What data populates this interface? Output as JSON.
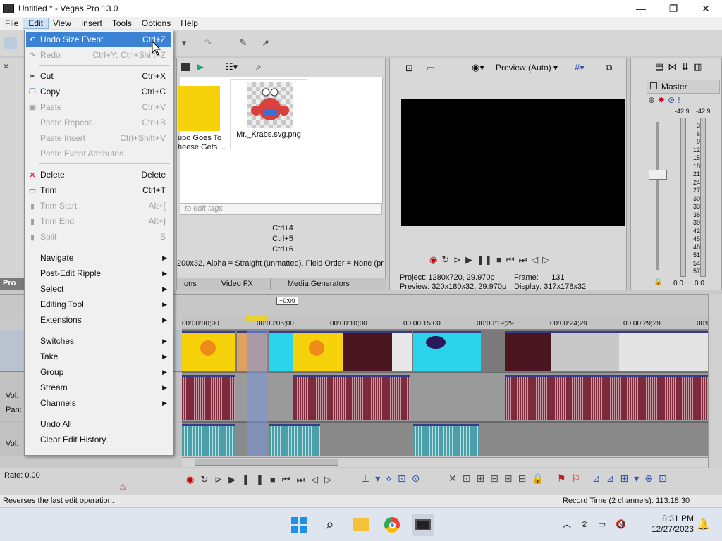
{
  "window": {
    "title": "Untitled * - Vegas Pro 13.0",
    "min": "—",
    "max": "❐",
    "close": "✕"
  },
  "menubar": [
    "File",
    "Edit",
    "View",
    "Insert",
    "Tools",
    "Options",
    "Help"
  ],
  "edit_menu": {
    "items": [
      {
        "label": "Undo Size Event",
        "shortcut": "Ctrl+Z",
        "state": "highlight",
        "icon": "undo-icon",
        "glyph": "↶"
      },
      {
        "label": "Redo",
        "shortcut": "Ctrl+Y; Ctrl+Shift+Z",
        "state": "disabled",
        "icon": "redo-icon",
        "glyph": "↷"
      },
      {
        "sep": true
      },
      {
        "label": "Cut",
        "shortcut": "Ctrl+X",
        "state": "normal",
        "icon": "scissors-icon",
        "glyph": "✂"
      },
      {
        "label": "Copy",
        "shortcut": "Ctrl+C",
        "state": "normal",
        "icon": "copy-icon",
        "glyph": "❐"
      },
      {
        "label": "Paste",
        "shortcut": "Ctrl+V",
        "state": "disabled",
        "icon": "paste-icon",
        "glyph": "▣"
      },
      {
        "label": "Paste Repeat...",
        "shortcut": "Ctrl+B",
        "state": "disabled"
      },
      {
        "label": "Paste Insert",
        "shortcut": "Ctrl+Shift+V",
        "state": "disabled"
      },
      {
        "label": "Paste Event Attributes",
        "shortcut": "",
        "state": "disabled"
      },
      {
        "sep": true
      },
      {
        "label": "Delete",
        "shortcut": "Delete",
        "state": "normal",
        "icon": "delete-icon",
        "glyph": "✕"
      },
      {
        "label": "Trim",
        "shortcut": "Ctrl+T",
        "state": "normal",
        "icon": "trim-icon",
        "glyph": "▭"
      },
      {
        "label": "Trim Start",
        "shortcut": "Alt+[",
        "state": "disabled",
        "icon": "trim-start-icon",
        "glyph": "▮"
      },
      {
        "label": "Trim End",
        "shortcut": "Alt+]",
        "state": "disabled",
        "icon": "trim-end-icon",
        "glyph": "▮"
      },
      {
        "label": "Split",
        "shortcut": "S",
        "state": "disabled",
        "icon": "split-icon",
        "glyph": "▮"
      },
      {
        "sep": true
      },
      {
        "label": "Navigate",
        "submenu": true,
        "state": "normal"
      },
      {
        "label": "Post-Edit Ripple",
        "submenu": true,
        "state": "normal"
      },
      {
        "label": "Select",
        "submenu": true,
        "state": "normal"
      },
      {
        "label": "Editing Tool",
        "submenu": true,
        "state": "normal"
      },
      {
        "label": "Extensions",
        "submenu": true,
        "state": "normal"
      },
      {
        "sep": true
      },
      {
        "label": "Switches",
        "submenu": true,
        "state": "normal"
      },
      {
        "label": "Take",
        "submenu": true,
        "state": "normal"
      },
      {
        "label": "Group",
        "submenu": true,
        "state": "normal"
      },
      {
        "label": "Stream",
        "submenu": true,
        "state": "normal"
      },
      {
        "label": "Channels",
        "submenu": true,
        "state": "normal"
      },
      {
        "sep": true
      },
      {
        "label": "Undo All",
        "shortcut": "",
        "state": "normal"
      },
      {
        "label": "Clear Edit History...",
        "shortcut": "",
        "state": "normal"
      }
    ]
  },
  "explorer": {
    "thumb1_caption_line1": "upo Goes To",
    "thumb1_caption_line2": "heese Gets ...",
    "thumb2_caption": "Mr._Krabs.svg.png",
    "tags_placeholder": "to edit tags",
    "shortcuts": [
      "Ctrl+4",
      "Ctrl+5",
      "Ctrl+6"
    ],
    "info": "200x32, Alpha = Straight (unmatted), Field Order = None (pr",
    "tabs": [
      "ons",
      "Video FX",
      "Media Generators"
    ],
    "left_tab": "Pro"
  },
  "preview": {
    "mode": "Preview (Auto)",
    "project_label": "Project:",
    "project_value": "1280x720, 29.970p",
    "preview_label": "Preview:",
    "preview_value": "320x180x32, 29.970p",
    "frame_label": "Frame:",
    "frame_value": "131",
    "display_label": "Display:",
    "display_value": "317x178x32"
  },
  "mixer": {
    "title": "Master",
    "peak_left": "-42.9",
    "peak_right": "-42.9",
    "scale": [
      "3",
      "6",
      "9",
      "12",
      "15",
      "18",
      "21",
      "24",
      "27",
      "30",
      "33",
      "36",
      "39",
      "42",
      "45",
      "48",
      "51",
      "54",
      "57"
    ],
    "fader_left": "0.0",
    "fader_right": "0.0"
  },
  "timeline": {
    "cursor_offset": "+0:09",
    "ruler": [
      "00:00:00;00",
      "00:00:05;00",
      "00:00:10;00",
      "00:00:15;00",
      "00:00:19;29",
      "00:00:24;29",
      "00:00:29;29",
      "00:0"
    ],
    "vol_label": "Vol:",
    "pan_label": "Pan:",
    "vol_label2": "Vol:"
  },
  "transport": {
    "rate_label": "Rate: 0.00"
  },
  "status": {
    "left": "Reverses the last edit operation.",
    "right": "Record Time (2 channels): 113:18:30"
  },
  "taskbar": {
    "time": "8:31 PM",
    "date": "12/27/2023"
  }
}
